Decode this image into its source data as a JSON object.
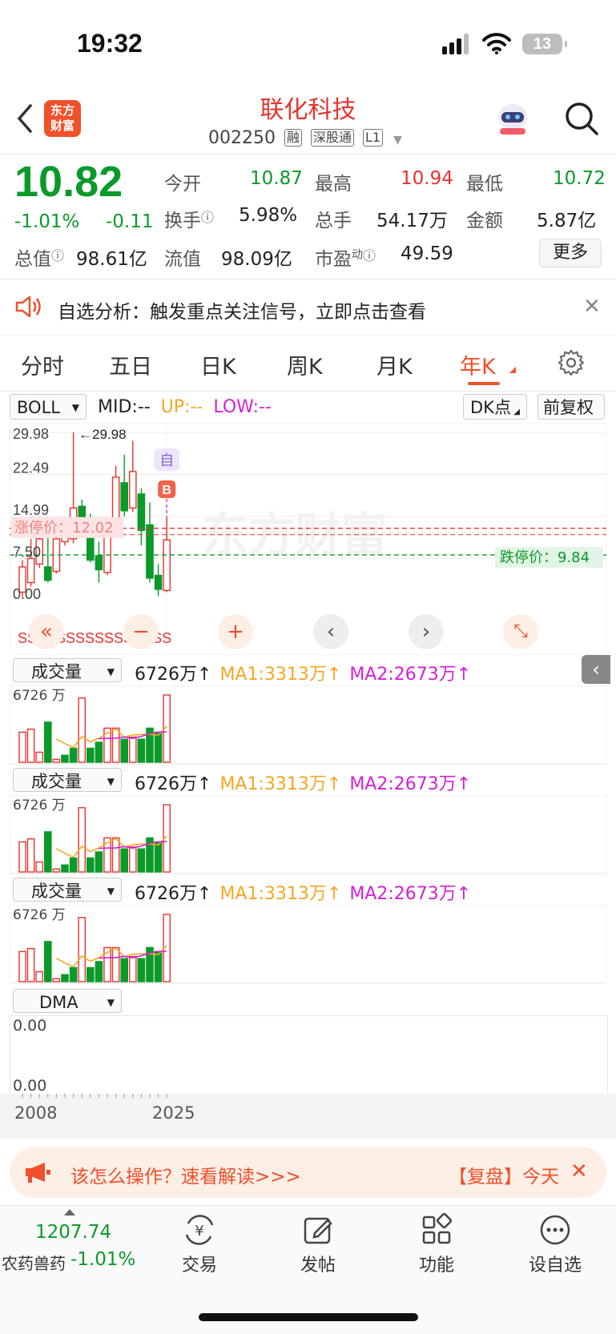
{
  "status_bar": {
    "time": "19:32",
    "battery": "13"
  },
  "header": {
    "logo_line1": "东方",
    "logo_line2": "财富",
    "stock_name": "联化科技",
    "stock_code": "002250",
    "tags": [
      "融",
      "深股通",
      "L1"
    ]
  },
  "quote": {
    "price": "10.82",
    "change_pct": "-1.01%",
    "change": "-0.11",
    "open_label": "今开",
    "open_value": "10.87",
    "high_label": "最高",
    "high_value": "10.94",
    "low_label": "最低",
    "low_value": "10.72",
    "turnover_label": "换手",
    "turnover_value": "5.98%",
    "volume_label": "总手",
    "volume_value": "54.17万",
    "amount_label": "金额",
    "amount_value": "5.87亿",
    "mktcap_label": "总值",
    "mktcap_value": "98.61亿",
    "float_label": "流值",
    "float_value": "98.09亿",
    "pe_label": "市盈",
    "pe_sup": "动",
    "pe_value": "49.59",
    "more_label": "更多"
  },
  "notice": {
    "text": "自选分析：触发重点关注信号，立即点击查看"
  },
  "tabs": [
    "分时",
    "五日",
    "日K",
    "周K",
    "月K",
    "年K"
  ],
  "active_tab": "年K",
  "kline": {
    "indicator": "BOLL",
    "mid_label": "MID:--",
    "up_label": "UP:--",
    "low_label": "LOW:--",
    "dk_label": "DK点",
    "adjust_label": "前复权",
    "y_ticks": [
      "29.98",
      "22.49",
      "14.99",
      "7.50",
      "0.00"
    ],
    "max_marker": "←29.98",
    "zi_badge": "自",
    "b_badge": "B",
    "limit_up_label": "涨停价：12.02",
    "limit_down_label": "跌停价：9.84",
    "s_marks": "SSSSSSSSSSSSSSSS",
    "watermark": "东方财富"
  },
  "volume_panels": [
    {
      "selector": "成交量",
      "value": "6726万↑",
      "ma1": "MA1:3313万↑",
      "ma2": "MA2:2673万↑",
      "top_label": "6726 万"
    },
    {
      "selector": "成交量",
      "value": "6726万↑",
      "ma1": "MA1:3313万↑",
      "ma2": "MA2:2673万↑",
      "top_label": "6726 万"
    },
    {
      "selector": "成交量",
      "value": "6726万↑",
      "ma1": "MA1:3313万↑",
      "ma2": "MA2:2673万↑",
      "top_label": "6726 万"
    }
  ],
  "dma": {
    "selector": "DMA",
    "top": "0.00",
    "bottom": "0.00"
  },
  "x_axis": {
    "start": "2008",
    "end": "2025"
  },
  "banner": {
    "left_text": "该怎么操作？速看解读>>>",
    "right_text": "【复盘】今天"
  },
  "bottom_nav": {
    "index_value": "1207.74",
    "index_name": "农药兽药",
    "index_change": "-1.01%",
    "trade": "交易",
    "post": "发帖",
    "functions": "功能",
    "set_watch": "设自选"
  },
  "colors": {
    "up": "#e8322d",
    "down": "#0a9a2a",
    "accent": "#f0502a",
    "ma1": "#f5a623",
    "ma2": "#d51fd6"
  },
  "chart_data": {
    "type": "candlestick",
    "price_axis": [
      0.0,
      29.98
    ],
    "candles": [
      {
        "o": 1.5,
        "c": 6.0,
        "h": 7.2,
        "l": 0.6
      },
      {
        "o": 3.2,
        "c": 7.5,
        "h": 11.0,
        "l": 2.5
      },
      {
        "o": 6.5,
        "c": 11.0,
        "h": 12.3,
        "l": 5.8
      },
      {
        "o": 6.0,
        "c": 3.6,
        "h": 11.8,
        "l": 3.2
      },
      {
        "o": 5.2,
        "c": 11.0,
        "h": 12.5,
        "l": 4.8
      },
      {
        "o": 10.5,
        "c": 14.0,
        "h": 14.8,
        "l": 9.8
      },
      {
        "o": 11.0,
        "c": 16.5,
        "h": 29.98,
        "l": 10.2
      },
      {
        "o": 16.8,
        "c": 13.2,
        "h": 18.0,
        "l": 12.0
      },
      {
        "o": 13.0,
        "c": 7.2,
        "h": 15.5,
        "l": 6.8
      },
      {
        "o": 8.0,
        "c": 5.5,
        "h": 10.5,
        "l": 3.2
      },
      {
        "o": 5.0,
        "c": 13.5,
        "h": 14.2,
        "l": 4.5
      },
      {
        "o": 12.0,
        "c": 22.0,
        "h": 24.0,
        "l": 11.2
      },
      {
        "o": 21.0,
        "c": 16.0,
        "h": 26.0,
        "l": 15.0
      },
      {
        "o": 16.5,
        "c": 23.0,
        "h": 28.5,
        "l": 15.8
      },
      {
        "o": 19.0,
        "c": 12.5,
        "h": 20.0,
        "l": 9.8
      },
      {
        "o": 13.5,
        "c": 4.0,
        "h": 17.5,
        "l": 3.2
      },
      {
        "o": 4.5,
        "c": 2.0,
        "h": 6.5,
        "l": 0.8
      },
      {
        "o": 1.8,
        "c": 10.82,
        "h": 14.8,
        "l": 1.5
      }
    ],
    "volumes": [
      30,
      33,
      10,
      40,
      3,
      7,
      14,
      64,
      14,
      20,
      34,
      34,
      23,
      25,
      23,
      34,
      30,
      67
    ],
    "volume_colors": [
      "up",
      "up",
      "up",
      "down",
      "up",
      "down",
      "down",
      "up",
      "down",
      "down",
      "up",
      "up",
      "down",
      "up",
      "down",
      "down",
      "down",
      "up"
    ]
  }
}
